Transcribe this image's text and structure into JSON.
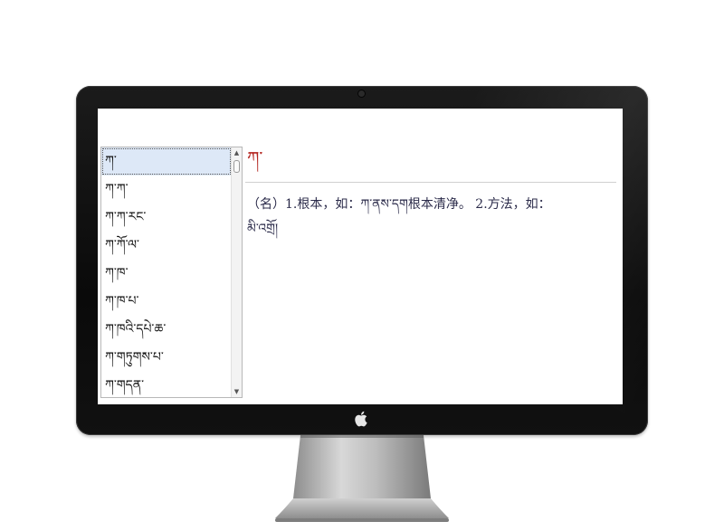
{
  "word_list": {
    "items": [
      "ཀ་",
      "ཀ་ཀ་",
      "ཀ་ཀ་རང་",
      "ཀ་ཀོ་ལ་",
      "ཀ་ཁ་",
      "ཀ་ཁ་པ་",
      "ཀ་ཁའི་དཔེ་ཆ་",
      "ཀ་གཏུགས་པ་",
      "ཀ་གདན་"
    ],
    "selected_index": 0
  },
  "entry": {
    "headword": "ཀ་",
    "definition_line1": "（名）1.根本，如：ཀ་ནས་དག根本清净。 2.方法，如：",
    "definition_line2": "མི་འགྲོ།"
  },
  "colors": {
    "headword": "#b3231d",
    "selection": "#dde8f7",
    "bezel": "#111111"
  }
}
